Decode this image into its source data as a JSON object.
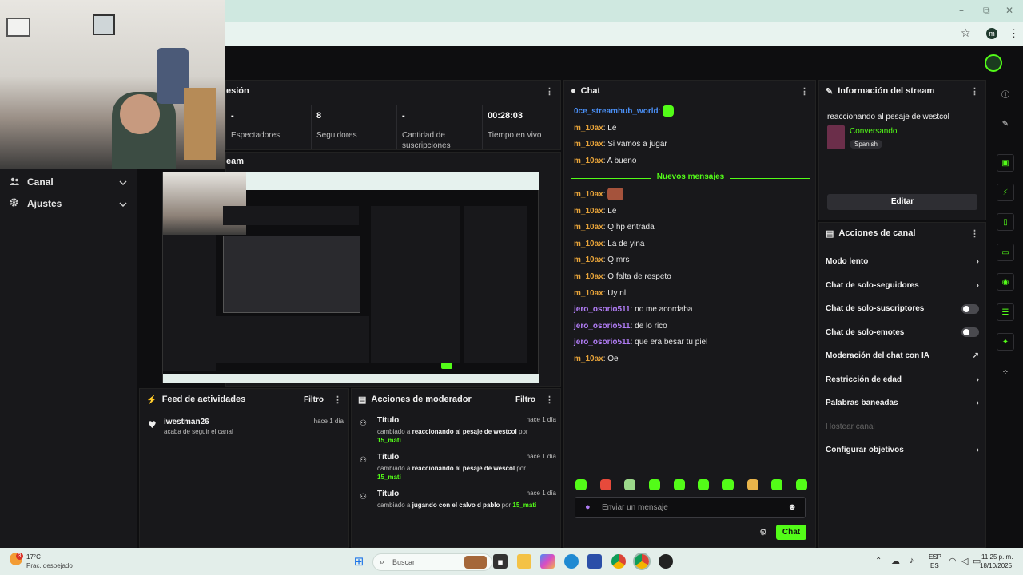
{
  "window": {
    "minimize": "–",
    "restore": "⧉",
    "close": "✕"
  },
  "browser": {
    "profile_initial": "m",
    "star": "☆",
    "menu": "⋮"
  },
  "sidebar": {
    "items": [
      {
        "label": "Canal",
        "icon": "users-icon"
      },
      {
        "label": "Ajustes",
        "icon": "gear-icon"
      }
    ]
  },
  "session": {
    "title_fragment": "esión",
    "stats": [
      {
        "value": "-",
        "label": "Espectadores"
      },
      {
        "value": "8",
        "label": "Seguidores"
      },
      {
        "value": "-",
        "label": "Cantidad de suscripciones"
      },
      {
        "value": "00:28:03",
        "label": "Tiempo en vivo"
      }
    ],
    "stream_fragment": "eam"
  },
  "chat": {
    "title": "Chat",
    "lines": [
      {
        "user": "0ce_streamhub_world",
        "text": "",
        "color": "blue",
        "emote": true
      },
      {
        "user": "m_10ax",
        "text": "Le",
        "color": "orange"
      },
      {
        "user": "m_10ax",
        "text": "Si vamos a jugar",
        "color": "orange"
      },
      {
        "user": "m_10ax",
        "text": "A bueno",
        "color": "orange"
      }
    ],
    "new_messages_label": "Nuevos mensajes",
    "new_lines": [
      {
        "user": "m_10ax",
        "text": "",
        "color": "orange",
        "emote": true
      },
      {
        "user": "m_10ax",
        "text": "Le",
        "color": "orange"
      },
      {
        "user": "m_10ax",
        "text": "Q hp entrada",
        "color": "orange"
      },
      {
        "user": "m_10ax",
        "text": "La de yina",
        "color": "orange"
      },
      {
        "user": "m_10ax",
        "text": "Q mrs",
        "color": "orange"
      },
      {
        "user": "m_10ax",
        "text": "Q falta de respeto",
        "color": "orange"
      },
      {
        "user": "m_10ax",
        "text": "Uy nl",
        "color": "orange"
      },
      {
        "user": "jero_osorio511",
        "text": "no me acordaba",
        "color": "purple"
      },
      {
        "user": "jero_osorio511",
        "text": "de lo rico",
        "color": "purple"
      },
      {
        "user": "jero_osorio511",
        "text": "que era besar tu piel",
        "color": "purple"
      },
      {
        "user": "m_10ax",
        "text": "Oe",
        "color": "orange"
      }
    ],
    "input_placeholder": "Enviar un mensaje",
    "send_label": "Chat"
  },
  "stream_info": {
    "title": "Información del stream",
    "stream_title": "reaccionando al pesaje de westcol",
    "category": "Conversando",
    "language": "Spanish",
    "edit_label": "Editar"
  },
  "channel_actions": {
    "title": "Acciones de canal",
    "items": [
      {
        "label": "Modo lento",
        "control": "chevron"
      },
      {
        "label": "Chat de solo-seguidores",
        "control": "chevron"
      },
      {
        "label": "Chat de solo-suscriptores",
        "control": "toggle"
      },
      {
        "label": "Chat de solo-emotes",
        "control": "toggle"
      },
      {
        "label": "Moderación del chat con IA",
        "control": "external"
      },
      {
        "label": "Restricción de edad",
        "control": "chevron"
      },
      {
        "label": "Palabras baneadas",
        "control": "chevron"
      },
      {
        "label": "Hostear canal",
        "control": "none",
        "disabled": true
      },
      {
        "label": "Configurar objetivos",
        "control": "chevron"
      }
    ]
  },
  "activity": {
    "title": "Feed de actividades",
    "filter_label": "Filtro",
    "items": [
      {
        "user": "iwestman26",
        "text": "acaba de seguir el canal",
        "time": "hace 1 día"
      }
    ]
  },
  "mod_actions": {
    "title": "Acciones de moderador",
    "filter_label": "Filtro",
    "items": [
      {
        "title": "Título",
        "prefix": "cambiado a",
        "value": "reaccionando al pesaje de westcol",
        "by": "por",
        "user": "15_mati",
        "time": "hace 1 día"
      },
      {
        "title": "Título",
        "prefix": "cambiado a",
        "value": "reaccionando al pesaje de wescol",
        "by": "por",
        "user": "15_mati",
        "time": "hace 1 día"
      },
      {
        "title": "Título",
        "prefix": "cambiado a",
        "value": "jugando con el calvo d pablo",
        "by": "por",
        "user": "15_mati",
        "time": "hace 1 día"
      }
    ]
  },
  "taskbar": {
    "weather_temp": "17°C",
    "weather_desc": "Prac. despejado",
    "notification_count": "3",
    "search_placeholder": "Buscar",
    "lang_line1": "ESP",
    "lang_line2": "ES",
    "time": "11:25 p. m.",
    "date": "18/10/2025"
  },
  "colors": {
    "accent": "#53fc18",
    "panel": "#18181b",
    "bg": "#0e0e10"
  }
}
